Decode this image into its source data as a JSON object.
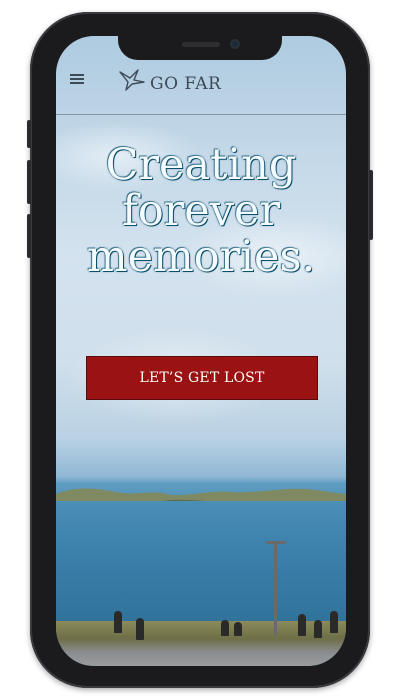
{
  "nav": {
    "menu_icon": "hamburger-icon",
    "logo_icon": "bird-logo-icon",
    "brand": "GO FAR"
  },
  "hero": {
    "headline_lines": [
      "Creating",
      "forever",
      "memories."
    ],
    "cta_label": "LET’S GET LOST"
  },
  "colors": {
    "cta_background": "#9a1212",
    "headline_text": "#f3fbff",
    "headline_outline": "#0a4f6b",
    "brand_text": "#3d4a57"
  }
}
